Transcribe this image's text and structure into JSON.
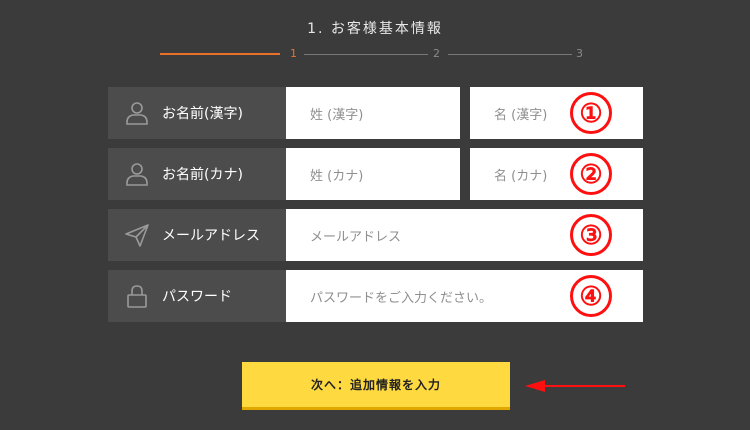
{
  "step_header": {
    "title": "1. お客様基本情報"
  },
  "progress": {
    "steps": [
      "1",
      "2",
      "3"
    ],
    "current": 1
  },
  "form": {
    "rows": [
      {
        "label": "お名前(漢字)",
        "icon": "person-icon",
        "inputs": [
          {
            "placeholder": "姓 (漢字)"
          },
          {
            "placeholder": "名 (漢字)"
          }
        ],
        "annotation": "①"
      },
      {
        "label": "お名前(カナ)",
        "icon": "person-icon",
        "inputs": [
          {
            "placeholder": "姓 (カナ)"
          },
          {
            "placeholder": "名 (カナ)"
          }
        ],
        "annotation": "②"
      },
      {
        "label": "メールアドレス",
        "icon": "paper-plane-icon",
        "inputs": [
          {
            "placeholder": "メールアドレス"
          }
        ],
        "annotation": "③"
      },
      {
        "label": "パスワード",
        "icon": "lock-icon",
        "inputs": [
          {
            "placeholder": "パスワードをご入力ください。"
          }
        ],
        "annotation": "④"
      }
    ]
  },
  "next_button": {
    "label": "次へ：追加情報を入力"
  },
  "colors": {
    "background": "#3b3b3b",
    "label_bg": "#4c4c4c",
    "accent_orange": "#e8702a",
    "button_yellow": "#ffd940",
    "annotation_red": "#ff1010"
  }
}
